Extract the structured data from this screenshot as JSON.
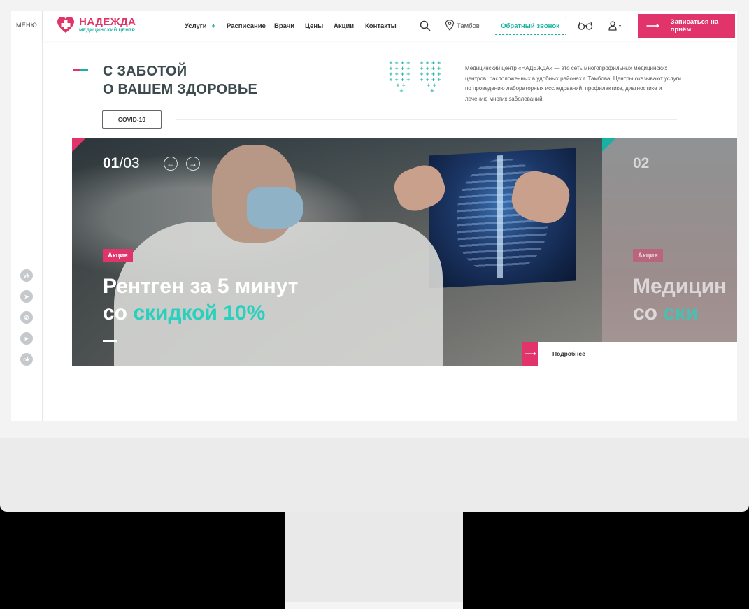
{
  "rail": {
    "menu_label": "МЕНЮ",
    "socials": [
      {
        "icon": "vk-icon",
        "glyph": "vk"
      },
      {
        "icon": "telegram-icon",
        "glyph": "➤"
      },
      {
        "icon": "whatsapp-icon",
        "glyph": "✆"
      },
      {
        "icon": "youtube-icon",
        "glyph": "▶"
      },
      {
        "icon": "odnoklassniki-icon",
        "glyph": "ok"
      }
    ]
  },
  "header": {
    "logo_name": "НАДЕЖДА",
    "logo_sub": "МЕДИЦИНСКИЙ ЦЕНТР",
    "nav": [
      {
        "label": "Услуги",
        "plus": "+"
      },
      {
        "label": "Расписание"
      },
      {
        "label": "Врачи"
      },
      {
        "label": "Цены"
      },
      {
        "label": "Акции"
      },
      {
        "label": "Контакты"
      }
    ],
    "city": "Тамбов",
    "callback_label": "Обратный звонок",
    "user_caret": "▾",
    "appointment_label": "Записаться на приём",
    "appointment_arrow": "⟶"
  },
  "hero": {
    "title_line1": "С ЗАБОТОЙ",
    "title_line2": "О ВАШЕМ ЗДОРОВЬЕ",
    "covid_label": "COVID-19",
    "about": "Медицинский центр «НАДЕЖДА» — это сеть многопрофильных медицинских центров, расположенных в удобных районах г. Тамбова. Центры оказывают услуги по проведению лабораторных исследований, профилактике, диагностике и лечению многих заболеваний."
  },
  "slider": {
    "current": "01",
    "total": "/03",
    "prev_glyph": "←",
    "next_glyph": "→",
    "badge": "Акция",
    "headline_line1": "Рентген за 5 минут",
    "headline_pre": "со ",
    "headline_highlight": "скидкой 10%",
    "next_slide": {
      "number": "02",
      "badge": "Акция",
      "headline_line1": "Медицин",
      "headline_pre": "со ",
      "headline_highlight": "ски"
    },
    "more_label": "Подробнее",
    "more_arrow": "⟶"
  },
  "colors": {
    "brand_pink": "#e0346a",
    "brand_teal": "#16b2a3"
  }
}
